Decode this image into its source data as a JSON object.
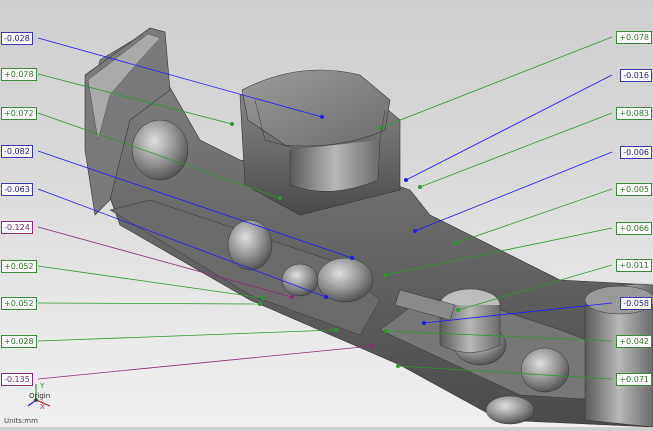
{
  "units_label": "Units:mm",
  "origin": {
    "label": "Origin",
    "axis_y": "Y",
    "axis_x": "X"
  },
  "colors": {
    "blue": "#1a1aff",
    "green": "#2a9a2a",
    "purple": "#8a2a7a"
  },
  "left_labels": [
    {
      "value": "-0.028",
      "color": "blue"
    },
    {
      "value": "+0.078",
      "color": "green"
    },
    {
      "value": "+0.072",
      "color": "green"
    },
    {
      "value": "-0.082",
      "color": "blue"
    },
    {
      "value": "-0.063",
      "color": "blue"
    },
    {
      "value": "-0.124",
      "color": "purple"
    },
    {
      "value": "+0.052",
      "color": "green"
    },
    {
      "value": "+0.052",
      "color": "green"
    },
    {
      "value": "+0.028",
      "color": "green"
    },
    {
      "value": "-0.135",
      "color": "purple"
    }
  ],
  "right_labels": [
    {
      "value": "+0.078",
      "color": "green"
    },
    {
      "value": "-0.016",
      "color": "blue"
    },
    {
      "value": "+0.083",
      "color": "green"
    },
    {
      "value": "-0.006",
      "color": "blue"
    },
    {
      "value": "+0.005",
      "color": "green"
    },
    {
      "value": "+0.066",
      "color": "green"
    },
    {
      "value": "+0.011",
      "color": "green"
    },
    {
      "value": "-0.058",
      "color": "blue"
    },
    {
      "value": "+0.042",
      "color": "green"
    },
    {
      "value": "+0.071",
      "color": "green"
    }
  ]
}
